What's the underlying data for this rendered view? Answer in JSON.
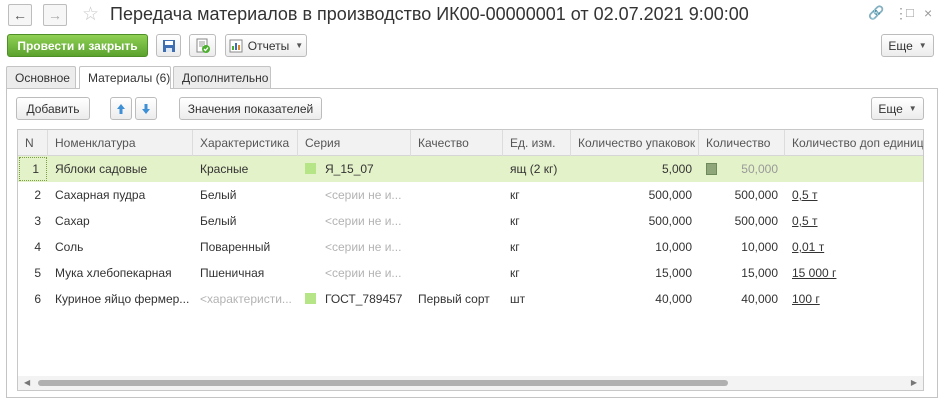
{
  "window": {
    "title": "Передача материалов в производство ИК00-00000001 от 02.07.2021 9:00:00"
  },
  "toolbar": {
    "post_close": "Провести и закрыть",
    "reports": "Отчеты",
    "more": "Еще"
  },
  "tabs": [
    "Основное",
    "Материалы (6)",
    "Дополнительно"
  ],
  "panel": {
    "add": "Добавить",
    "indicators": "Значения показателей",
    "more": "Еще"
  },
  "table": {
    "columns": [
      "N",
      "Номенклатура",
      "Характеристика",
      "Серия",
      "Качество",
      "Ед. изм.",
      "Количество упаковок",
      "Количество",
      "Количество доп единиц"
    ],
    "rows": [
      {
        "n": "1",
        "item": "Яблоки садовые",
        "char": "Красные",
        "series": "Я_15_07",
        "quality": "",
        "unit": "ящ (2 кг)",
        "packs": "5,000",
        "qty": "50,000",
        "extra": ""
      },
      {
        "n": "2",
        "item": "Сахарная пудра",
        "char": "Белый",
        "series": "<серии не и...",
        "quality": "",
        "unit": "кг",
        "packs": "500,000",
        "qty": "500,000",
        "extra": "0,5 т"
      },
      {
        "n": "3",
        "item": "Сахар",
        "char": "Белый",
        "series": "<серии не и...",
        "quality": "",
        "unit": "кг",
        "packs": "500,000",
        "qty": "500,000",
        "extra": "0,5 т"
      },
      {
        "n": "4",
        "item": "Соль",
        "char": "Поваренный",
        "series": "<серии не и...",
        "quality": "",
        "unit": "кг",
        "packs": "10,000",
        "qty": "10,000",
        "extra": "0,01 т"
      },
      {
        "n": "5",
        "item": "Мука хлебопекарная",
        "char": "Пшеничная",
        "series": "<серии не и...",
        "quality": "",
        "unit": "кг",
        "packs": "15,000",
        "qty": "15,000",
        "extra": "15 000 г"
      },
      {
        "n": "6",
        "item": "Куриное яйцо фермер...",
        "char": "<характеристи...",
        "series": "ГОСТ_789457",
        "quality": "Первый сорт",
        "unit": "шт",
        "packs": "40,000",
        "qty": "40,000",
        "extra": "100 г"
      }
    ]
  }
}
